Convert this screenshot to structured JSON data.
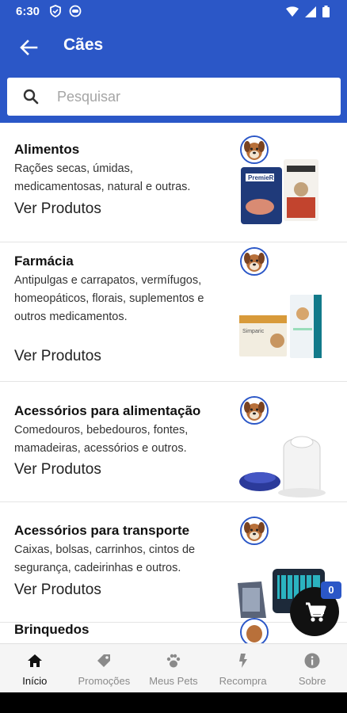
{
  "status_bar": {
    "time": "6:30"
  },
  "toolbar": {
    "title": "Cães"
  },
  "search": {
    "placeholder": "Pesquisar"
  },
  "categories": [
    {
      "title": "Alimentos",
      "description": "Rações secas, úmidas, medicamentosas, natural e outras.",
      "link": "Ver Produtos"
    },
    {
      "title": "Farmácia",
      "description": "Antipulgas e carrapatos, vermífugos, homeopáticos, florais, suplementos e outros medicamentos.",
      "link": "Ver Produtos"
    },
    {
      "title": "Acessórios para alimentação",
      "description": "Comedouros, bebedouros, fontes, mamadeiras, acessórios e outros.",
      "link": "Ver Produtos"
    },
    {
      "title": "Acessórios para transporte",
      "description": "Caixas, bolsas, carrinhos, cintos de segurança, cadeirinhas e outros.",
      "link": "Ver Produtos"
    },
    {
      "title": "Brinquedos",
      "description": "",
      "link": ""
    }
  ],
  "cart": {
    "count": "0"
  },
  "bottom_nav": [
    {
      "label": "Início",
      "icon": "home-icon",
      "active": true
    },
    {
      "label": "Promoções",
      "icon": "tag-icon",
      "active": false
    },
    {
      "label": "Meus Pets",
      "icon": "paw-icon",
      "active": false
    },
    {
      "label": "Recompra",
      "icon": "lightning-icon",
      "active": false
    },
    {
      "label": "Sobre",
      "icon": "info-icon",
      "active": false
    }
  ],
  "colors": {
    "primary": "#2b57c7",
    "fab": "#111111",
    "nav_background": "#f5f5f5"
  }
}
